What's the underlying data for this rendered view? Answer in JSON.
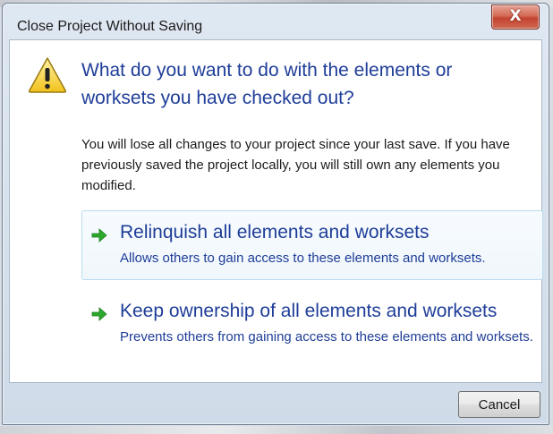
{
  "dialog": {
    "title": "Close Project Without Saving",
    "close_glyph": "X",
    "main_instruction": "What do you want to do with the elements or worksets you have checked out?",
    "body": "You will lose all changes to your project since your last save. If you have previously saved the project locally, you will still own any elements you modified.",
    "options": [
      {
        "title": "Relinquish all elements and worksets",
        "description": "Allows others to gain access to these elements and worksets.",
        "icon": "green-arrow-icon"
      },
      {
        "title": "Keep ownership of all elements and worksets",
        "description": "Prevents others from gaining access to these elements and worksets.",
        "icon": "green-arrow-icon"
      }
    ],
    "cancel_label": "Cancel",
    "icon": "warning-icon"
  },
  "colors": {
    "instruction_blue": "#1e3d98",
    "close_red": "#c24431",
    "arrow_green": "#2da82d"
  }
}
